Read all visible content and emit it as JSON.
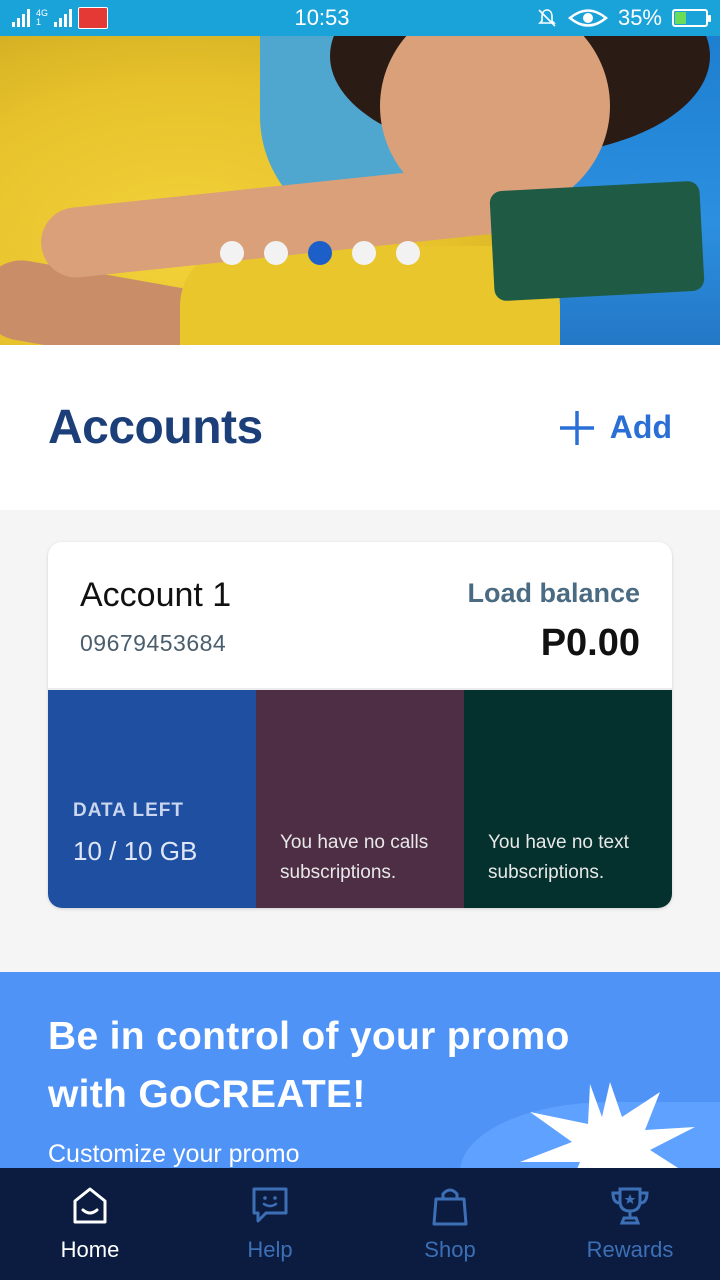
{
  "status_bar": {
    "network_top": "4G",
    "network_bottom": "1",
    "time": "10:53",
    "battery_percent": "35%",
    "battery_level": 0.35
  },
  "hero": {
    "slide_count": 5,
    "active_slide": 3
  },
  "accounts": {
    "title": "Accounts",
    "add_label": "Add"
  },
  "account_card": {
    "name": "Account 1",
    "number": "09679453684",
    "balance_label": "Load balance",
    "balance_value": "P0.00",
    "data_label": "DATA LEFT",
    "data_value": "10 / 10 GB",
    "calls_text": "You have no calls subscriptions.",
    "texts_text": "You have no text subscriptions."
  },
  "promo": {
    "title_line1": "Be in control of your promo",
    "title_line2": "with GoCREATE!",
    "subtitle": "Customize your promo"
  },
  "nav": {
    "items": [
      {
        "label": "Home",
        "icon": "home-icon"
      },
      {
        "label": "Help",
        "icon": "chat-icon"
      },
      {
        "label": "Shop",
        "icon": "shopping-bag-icon"
      },
      {
        "label": "Rewards",
        "icon": "trophy-icon"
      }
    ],
    "active": "Home"
  },
  "colors": {
    "status_bar": "#1aa3d9",
    "accent_blue": "#2a6fd6",
    "title_navy": "#1c3f7a",
    "data_tile": "#1f4fa1",
    "calls_tile": "#4e2e44",
    "texts_tile": "#04302d",
    "promo_bg": "#4f93f7",
    "nav_bg": "#0b1c40"
  }
}
